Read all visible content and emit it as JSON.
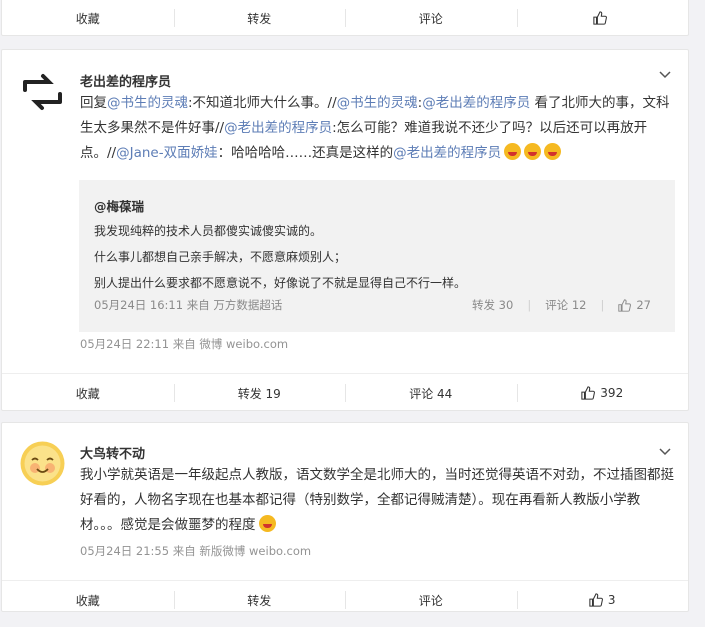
{
  "top_actions": {
    "collect": "收藏",
    "repost": "转发",
    "comment": "评论"
  },
  "post1": {
    "username": "老出差的程序员",
    "text": {
      "reply": "回复",
      "at1": "@书生的灵魂",
      "t1": ":不知道北师大什么事。//",
      "at2": "@书生的灵魂",
      "t2": ":",
      "at3": "@老出差的程序员",
      "t3": " 看了北师大的事，文科生太多果然不是件好事//",
      "at4": "@老出差的程序员",
      "t4": ":怎么可能？难道我说不还少了吗？以后还可以再放开点。//",
      "at5": "@Jane-双面娇娃",
      "t5": "：哈哈哈哈……还真是这样的",
      "at6": "@老出差的程序员"
    },
    "quote": {
      "name": "@梅葆瑞",
      "line1": "我发现纯粹的技术人员都傻实诚傻实诚的。",
      "line2": "什么事儿都想自己亲手解决，不愿意麻烦别人；",
      "line3": "别人提出什么要求都不愿意说不，好像说了不就是显得自己不行一样。",
      "meta": "05月24日 16:11 来自 万方数据超话",
      "repost": "转发 30",
      "comment": "评论 12",
      "likes": "27"
    },
    "meta": "05月24日 22:11  来自 微博 weibo.com",
    "actions": {
      "collect": "收藏",
      "repost": "转发 19",
      "comment": "评论 44",
      "likes": "392"
    }
  },
  "post2": {
    "username": "大鸟转不动",
    "text": "我小学就英语是一年级起点人教版，语文数学全是北师大的，当时还觉得英语不对劲，不过插图都挺好看的，人物名字现在也基本都记得（特别数学，全都记得贼清楚）。现在再看新人教版小学教材。。。感觉是会做噩梦的程度",
    "meta": "05月24日 21:55  来自 新版微博 weibo.com",
    "actions": {
      "collect": "收藏",
      "repost": "转发",
      "comment": "评论",
      "likes": "3"
    }
  },
  "colors": {
    "link": "#5d7db6",
    "meta": "#939393",
    "quote_bg": "#f2f2f2",
    "page_bg": "#f2f2f5"
  }
}
